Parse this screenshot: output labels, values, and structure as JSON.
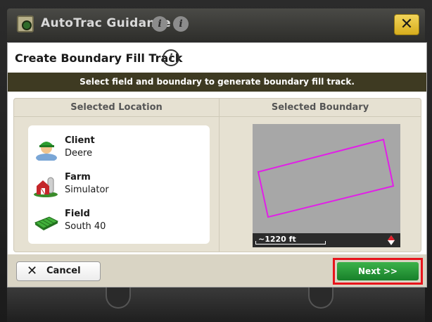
{
  "topbar": {
    "title": "AutoTrac Guidance",
    "info_icons": [
      "info-icon",
      "info-icon"
    ],
    "close_symbol": "✕"
  },
  "dialog": {
    "title": "Create Boundary Fill Track",
    "info_symbol": "i",
    "banner": "Select field and boundary to generate boundary fill track."
  },
  "location": {
    "header": "Selected Location",
    "items": [
      {
        "name": "Client",
        "value": "Deere",
        "icon": "client-icon"
      },
      {
        "name": "Farm",
        "value": "Simulator",
        "icon": "farm-icon"
      },
      {
        "name": "Field",
        "value": "South 40",
        "icon": "field-icon"
      }
    ]
  },
  "boundary": {
    "header": "Selected Boundary",
    "scale": "~1220 ft",
    "boundary_color": "#e21ee8",
    "map_background": "#a7a7a7"
  },
  "footer": {
    "cancel_label": "Cancel",
    "cancel_symbol": "✕",
    "next_label": "Next >>",
    "highlight_color": "#e8141b",
    "next_color": "#1f8f31"
  }
}
